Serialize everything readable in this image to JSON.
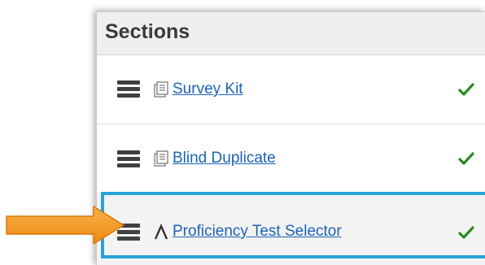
{
  "panel": {
    "title": "Sections"
  },
  "sections": [
    {
      "label": "Survey Kit",
      "type_icon": "document-stack-icon",
      "status_icon": "checkmark-icon",
      "selected": false
    },
    {
      "label": "Blind Duplicate",
      "type_icon": "document-stack-icon",
      "status_icon": "checkmark-icon",
      "selected": false
    },
    {
      "label": "Proficiency Test Selector",
      "type_icon": "lambda-icon",
      "status_icon": "checkmark-icon",
      "selected": true
    }
  ],
  "colors": {
    "link": "#1c63b6",
    "check": "#2a8a1f",
    "highlight": "#29a3d9",
    "arrow": "#f39c22"
  },
  "annotation": {
    "icon": "orange-arrow-icon"
  }
}
